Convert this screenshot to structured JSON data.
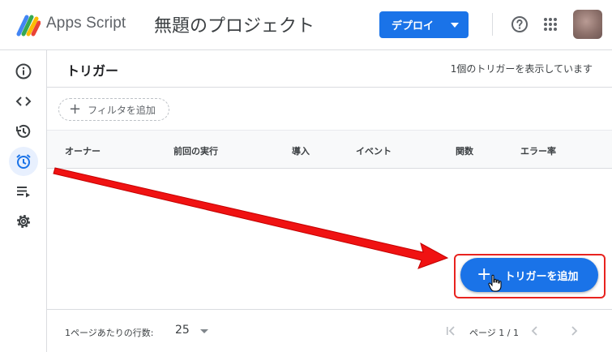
{
  "header": {
    "app_name": "Apps Script",
    "project_title": "無題のプロジェクト",
    "deploy_label": "デプロイ",
    "help_icon": "help-icon",
    "apps_icon": "apps-grid-icon"
  },
  "rail": {
    "items": [
      {
        "name": "overview",
        "icon": "info-icon"
      },
      {
        "name": "editor",
        "icon": "code-icon"
      },
      {
        "name": "executions",
        "icon": "history-icon"
      },
      {
        "name": "triggers",
        "icon": "alarm-icon",
        "active": true
      },
      {
        "name": "executions-log",
        "icon": "playlist-icon"
      },
      {
        "name": "settings",
        "icon": "gear-icon"
      }
    ]
  },
  "main": {
    "title": "トリガー",
    "count_text": "1個のトリガーを表示しています",
    "filter_label": "フィルタを追加",
    "columns": [
      "オーナー",
      "前回の実行",
      "導入",
      "イベント",
      "関数",
      "エラー率"
    ],
    "add_trigger_label": "トリガーを追加",
    "footer": {
      "rows_per_page_label": "1ページあたりの行数:",
      "rows_per_page_value": "25",
      "page_label": "ページ 1 / 1"
    }
  },
  "colors": {
    "primary": "#1a73e8",
    "annotation_red": "#e8231f",
    "active_rail": "#e8f0fe"
  }
}
